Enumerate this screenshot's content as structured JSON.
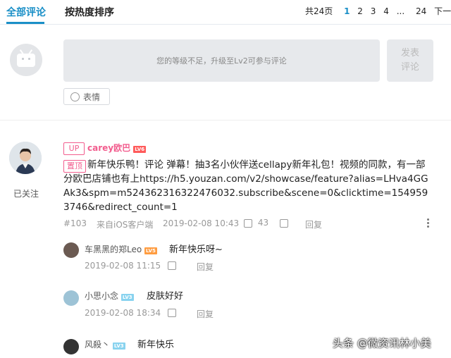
{
  "tabs": {
    "all": "全部评论",
    "hot": "按热度排序"
  },
  "pager": {
    "total": "共24页",
    "pages": [
      "1",
      "2",
      "3",
      "4",
      "...",
      "24"
    ],
    "next": "下一页"
  },
  "comment_box": {
    "placeholder": "您的等级不足，升级至Lv2可参与评论",
    "send_line1": "发表",
    "send_line2": "评论",
    "emoji": "表情"
  },
  "main_comment": {
    "up_label": "UP",
    "username": "carey欧巴",
    "level": "LV6",
    "follow_status": "已关注",
    "pinned": "置顶",
    "text": "新年快乐鸭！评论   弹幕！抽3名小伙伴送cellapy新年礼包！视频的同款，有一部分欧巴店铺也有上https://h5.youzan.com/v2/showcase/feature?alias=LHva4GGAk3&spm=m524362316322476032.subscribe&scene=0&clicktime=1549593746&redirect_count=1",
    "floor": "#103",
    "device": "来自iOS客户端",
    "time": "2019-02-08 10:43",
    "likes": "43",
    "reply": "回复"
  },
  "replies": [
    {
      "username": "车黑黑的郑Leo",
      "level": "LV5",
      "text": "新年快乐呀~",
      "time": "2019-02-08 11:15",
      "reply": "回复"
    },
    {
      "username": "小思小念",
      "level": "LV3",
      "text": "皮肤好好",
      "time": "2019-02-08 18:34",
      "reply": "回复"
    },
    {
      "username": "风殺丶",
      "level": "LV3",
      "text": "新年快乐",
      "time": "",
      "reply": ""
    }
  ],
  "watermark": "头条 @微资讯林小美",
  "colors": {
    "accent": "#1a8fc7",
    "up_pink": "#f25d8e",
    "panel": "#e7e9ec"
  }
}
